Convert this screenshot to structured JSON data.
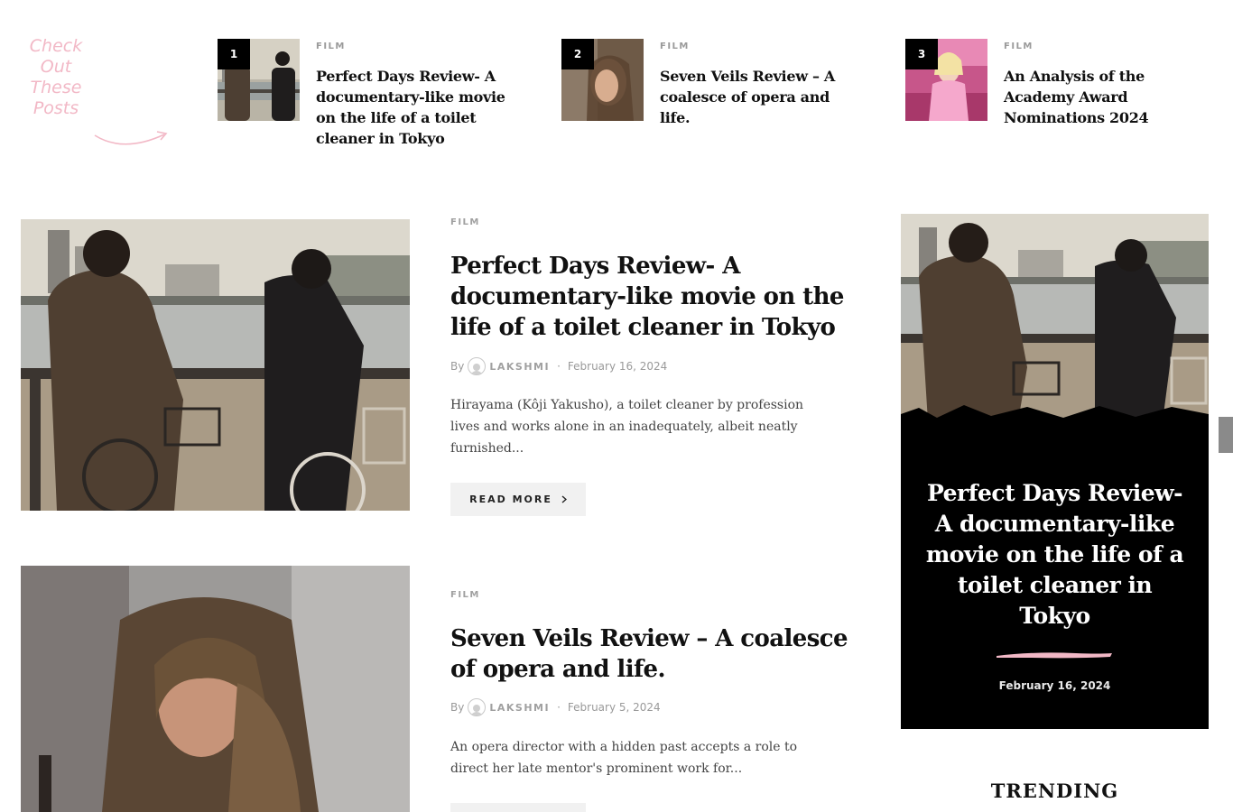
{
  "promo": {
    "check_out_lines": [
      "Check",
      "Out",
      "These",
      "Posts"
    ]
  },
  "top_posts": [
    {
      "number": "1",
      "category": "FILM",
      "title": "Perfect Days Review- A documentary-like movie on the life of a toilet cleaner in Tokyo"
    },
    {
      "number": "2",
      "category": "FILM",
      "title": "Seven Veils Review – A coalesce of opera and life."
    },
    {
      "number": "3",
      "category": "FILM",
      "title": "An Analysis of the Academy Award Nominations 2024"
    }
  ],
  "articles": [
    {
      "category": "FILM",
      "title": "Perfect Days Review- A documentary-like movie on the life of a toilet cleaner in Tokyo",
      "by": "By",
      "author": "LAKSHMI",
      "separator": "·",
      "date": "February 16, 2024",
      "excerpt": "Hirayama (Kôji Yakusho), a toilet cleaner by profession lives and works alone in an inadequately, albeit neatly furnished...",
      "read_more": "READ MORE"
    },
    {
      "category": "FILM",
      "title": "Seven Veils Review – A coalesce of opera and life.",
      "by": "By",
      "author": "LAKSHMI",
      "separator": "·",
      "date": "February 5, 2024",
      "excerpt": "An opera director with a hidden past accepts a role to direct her late mentor's prominent work for..."
    }
  ],
  "featured": {
    "title": "Perfect Days Review- A documentary-like movie on the life of a toilet cleaner in Tokyo",
    "date": "February 16, 2024"
  },
  "sidebar": {
    "trending_heading": "TRENDING"
  },
  "colors": {
    "accent_pink": "#f2b8c6",
    "feature_bg": "#000000",
    "button_bg": "#f1f1f1"
  }
}
